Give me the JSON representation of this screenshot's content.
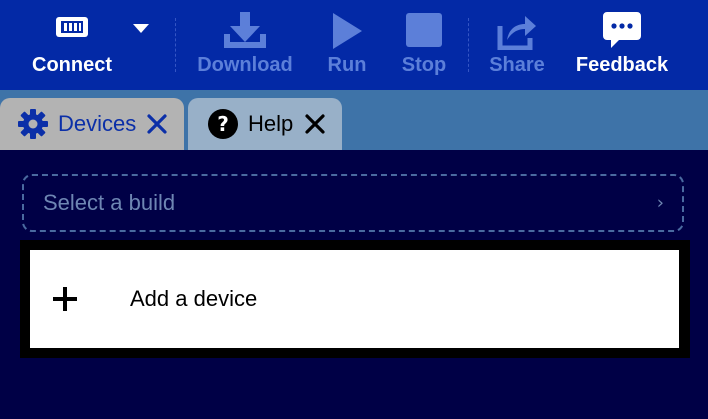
{
  "toolbar": {
    "connect_label": "Connect",
    "download_label": "Download",
    "run_label": "Run",
    "stop_label": "Stop",
    "share_label": "Share",
    "feedback_label": "Feedback",
    "icons": {
      "connect": "usb-device-icon",
      "connect_menu": "caret-down-icon",
      "download": "download-icon",
      "run": "play-icon",
      "stop": "stop-icon",
      "share": "share-icon",
      "feedback": "speech-bubble-icon"
    },
    "colors": {
      "background": "#0329a6",
      "enabled_text": "#ffffff",
      "disabled_text": "#5c7fd9"
    }
  },
  "tabs": [
    {
      "label": "Devices",
      "icon": "gear-icon",
      "active": true
    },
    {
      "label": "Help",
      "icon": "question-circle-icon",
      "active": false
    }
  ],
  "main": {
    "build_select": {
      "placeholder": "Select a build",
      "icon": "chevron-right-icon"
    },
    "device_list": {
      "add_device_label": "Add a device",
      "add_icon": "plus-icon"
    },
    "colors": {
      "background": "#000046",
      "tabbar": "#3e73a8"
    }
  }
}
